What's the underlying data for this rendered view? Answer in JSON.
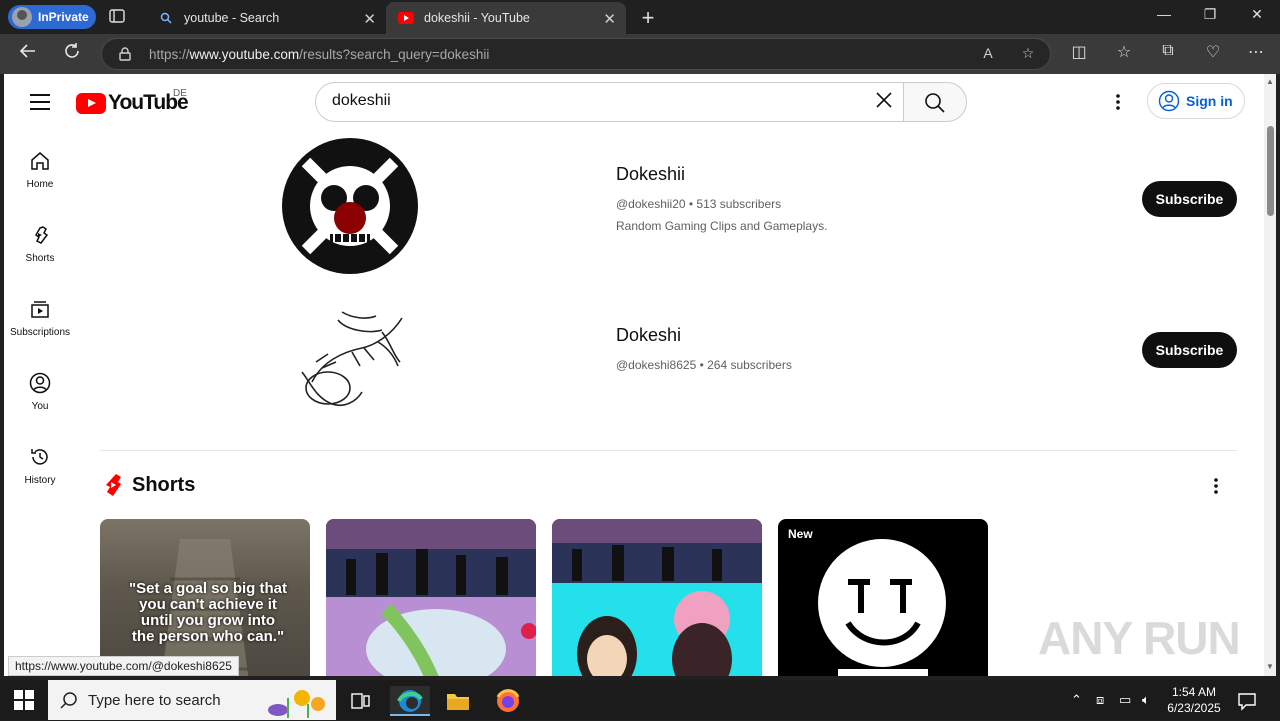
{
  "browser": {
    "inprivate_label": "InPrivate",
    "tabs": [
      {
        "title": "youtube - Search",
        "active": false
      },
      {
        "title": "dokeshii - YouTube",
        "active": true
      }
    ],
    "url_prefix": "https://",
    "url_host": "www.youtube.com",
    "url_path": "/results?search_query=dokeshii"
  },
  "youtube": {
    "logo_text": "YouTube",
    "country_code": "DE",
    "search_value": "dokeshii",
    "signin_label": "Sign in",
    "sidebar": [
      {
        "label": "Home",
        "icon": "home-icon"
      },
      {
        "label": "Shorts",
        "icon": "shorts-icon"
      },
      {
        "label": "Subscriptions",
        "icon": "subscriptions-icon"
      },
      {
        "label": "You",
        "icon": "you-icon"
      },
      {
        "label": "History",
        "icon": "history-icon"
      }
    ],
    "channels": [
      {
        "name": "Dokeshii",
        "handle_subs": "@dokeshii20 • 513 subscribers",
        "description": "Random Gaming Clips and Gameplays.",
        "subscribe_label": "Subscribe"
      },
      {
        "name": "Dokeshi",
        "handle_subs": "@dokeshi8625 • 264 subscribers",
        "description": "",
        "subscribe_label": "Subscribe"
      }
    ],
    "shorts_heading": "Shorts",
    "shorts": [
      {
        "overlay_text": "\"Set a goal so big that you can't achieve it until you grow into the person who can.\"",
        "badge": ""
      },
      {
        "overlay_text": "",
        "badge": ""
      },
      {
        "overlay_text": "",
        "badge": ""
      },
      {
        "overlay_text": "",
        "badge": "New"
      }
    ],
    "status_url": "https://www.youtube.com/@dokeshi8625",
    "watermark": "ANY RUN"
  },
  "taskbar": {
    "search_placeholder": "Type here to search",
    "time": "1:54 AM",
    "date": "6/23/2025"
  },
  "colors": {
    "youtube_red": "#ff0000",
    "subscribe_bg": "#0f0f0f",
    "signin_blue": "#065fd4",
    "inprivate_blue": "#2d6ad4"
  }
}
